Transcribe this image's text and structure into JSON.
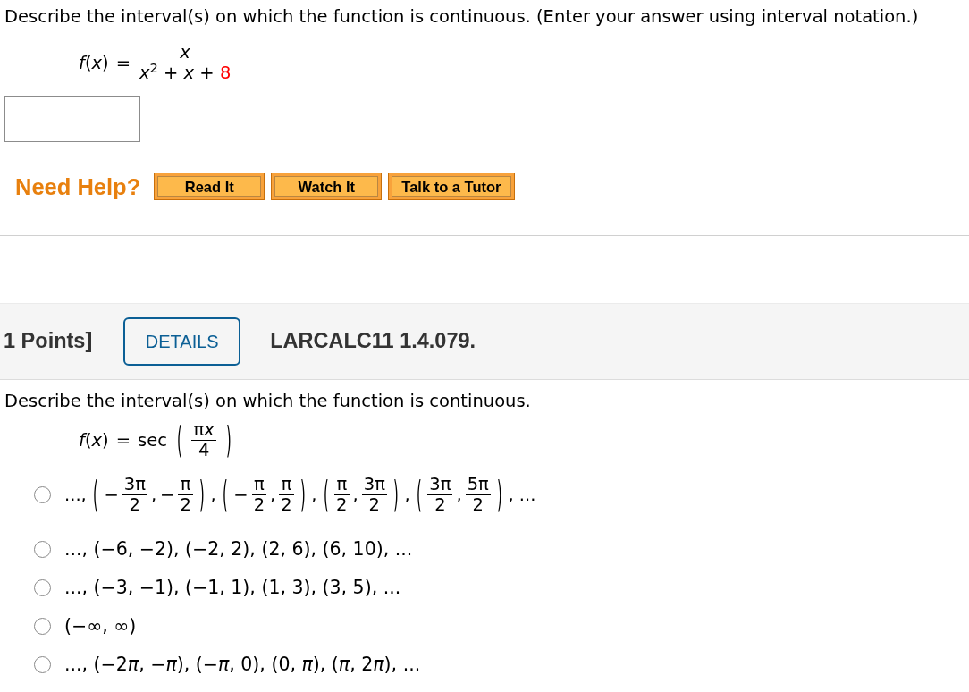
{
  "questions": [
    {
      "prompt": "Describe the interval(s) on which the function is continuous. (Enter your answer using interval notation.)",
      "formula": [
        {
          "kind": "text",
          "text": "*f*(*x*)"
        },
        {
          "kind": "text",
          "text": "="
        },
        {
          "kind": "frac",
          "num": "*x*",
          "den": [
            {
              "text": "*x*$^{2}$ + *x* + ",
              "highlight": false
            },
            {
              "text": "8",
              "highlight": true
            }
          ]
        }
      ],
      "answer": {
        "kind": "text"
      },
      "help": {
        "label": "Need Help?",
        "buttons": [
          "Read It",
          "Watch It",
          "Talk to a Tutor"
        ]
      }
    },
    {
      "header": {
        "points": "1 Points]",
        "details_button": "DETAILS",
        "reference": "LARCALC11 1.4.079."
      },
      "prompt": "Describe the interval(s) on which the function is continuous.",
      "formula": [
        {
          "kind": "text",
          "text": "*f*(*x*)"
        },
        {
          "kind": "text",
          "text": "="
        },
        {
          "kind": "text",
          "text": "sec"
        },
        {
          "kind": "paren",
          "text": "("
        },
        {
          "kind": "frac",
          "num": [
            "π",
            "*x*"
          ],
          "den": "4"
        },
        {
          "kind": "paren",
          "text": ")"
        }
      ],
      "answer": {
        "kind": "choice",
        "options": [
          {
            "kind": "fractions",
            "selected": false,
            "tokens": [
              {
                "kind": "text",
                "text": "...,"
              },
              {
                "kind": "paren",
                "text": "("
              },
              {
                "kind": "text",
                "text": "−"
              },
              {
                "kind": "frac",
                "num": "3π",
                "den": "2"
              },
              {
                "kind": "text",
                "text": ","
              },
              {
                "kind": "text",
                "text": "−"
              },
              {
                "kind": "frac",
                "num": "π",
                "den": "2"
              },
              {
                "kind": "paren",
                "text": ")"
              },
              {
                "kind": "text",
                "text": ","
              },
              {
                "kind": "paren",
                "text": "("
              },
              {
                "kind": "text",
                "text": "−"
              },
              {
                "kind": "frac",
                "num": "π",
                "den": "2"
              },
              {
                "kind": "text",
                "text": ","
              },
              {
                "kind": "frac",
                "num": "π",
                "den": "2"
              },
              {
                "kind": "paren",
                "text": ")"
              },
              {
                "kind": "text",
                "text": ","
              },
              {
                "kind": "paren",
                "text": "("
              },
              {
                "kind": "frac",
                "num": "π",
                "den": "2"
              },
              {
                "kind": "text",
                "text": ","
              },
              {
                "kind": "frac",
                "num": "3π",
                "den": "2"
              },
              {
                "kind": "paren",
                "text": ")"
              },
              {
                "kind": "text",
                "text": ","
              },
              {
                "kind": "paren",
                "text": "("
              },
              {
                "kind": "frac",
                "num": "3π",
                "den": "2"
              },
              {
                "kind": "text",
                "text": ","
              },
              {
                "kind": "frac",
                "num": "5π",
                "den": "2"
              },
              {
                "kind": "paren",
                "text": ")"
              },
              {
                "kind": "text",
                "text": ", ..."
              }
            ]
          },
          {
            "kind": "text",
            "selected": false,
            "text": "..., (−6, −2), (−2, 2), (2, 6), (6, 10), ..."
          },
          {
            "kind": "text",
            "selected": false,
            "text": "..., (−3, −1), (−1, 1), (1, 3), (3, 5), ..."
          },
          {
            "kind": "text",
            "selected": false,
            "text": "(−∞, ∞)"
          },
          {
            "kind": "parts",
            "selected": false,
            "parts": [
              "..., (−2",
              "*π*, −*π*), (−*π*, 0), (0, *π*), (*π*, 2",
              "*π*), ..."
            ]
          }
        ]
      }
    }
  ]
}
